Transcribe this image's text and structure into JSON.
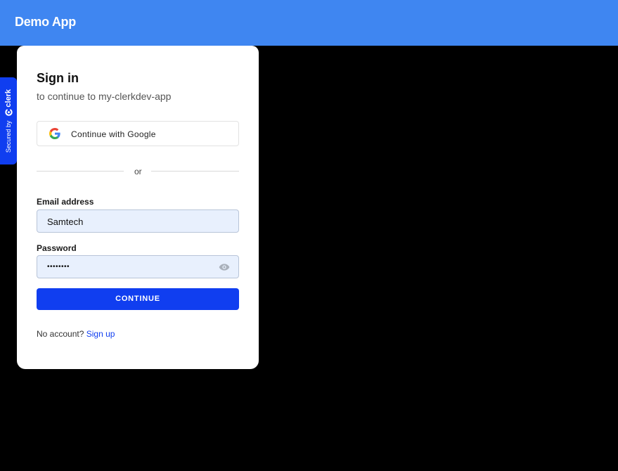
{
  "header": {
    "app_title": "Demo App"
  },
  "badge": {
    "secured_by": "Secured by",
    "brand": "clerk"
  },
  "signin": {
    "title": "Sign in",
    "subtitle": "to continue to my-clerkdev-app",
    "google_button_label": "Continue with Google",
    "divider_text": "or",
    "email_label": "Email address",
    "email_value": "Samtech",
    "password_label": "Password",
    "password_value": "••••••••",
    "continue_label": "CONTINUE",
    "no_account_text": "No account?",
    "signup_link": "Sign up"
  },
  "colors": {
    "header_bg": "#3f86f1",
    "primary": "#103ef0",
    "input_bg": "#e8f0fd",
    "page_bg": "#000000"
  },
  "icons": {
    "google": "google-icon",
    "eye": "eye-icon",
    "clerk": "clerk-logo-icon"
  }
}
